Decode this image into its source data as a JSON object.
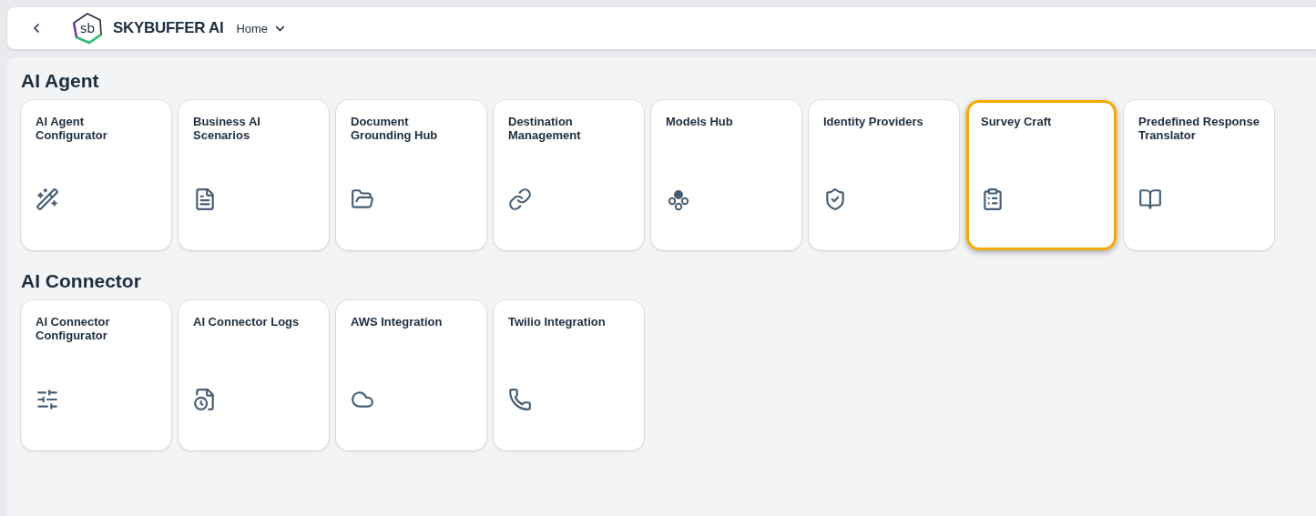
{
  "header": {
    "brand": "SKYBUFFER AI",
    "logo_text": "sb",
    "menu": "Home"
  },
  "groups": [
    {
      "title": "AI Agent",
      "tiles": [
        {
          "title": "AI Agent Configurator",
          "selected": false
        },
        {
          "title": "Business AI Scenarios",
          "selected": false
        },
        {
          "title": "Document Grounding Hub",
          "selected": false
        },
        {
          "title": "Destination Management",
          "selected": false
        },
        {
          "title": "Models Hub",
          "selected": false
        },
        {
          "title": "Identity Providers",
          "selected": false
        },
        {
          "title": "Survey Craft",
          "selected": true
        },
        {
          "title": "Predefined Response Translator",
          "selected": false
        }
      ]
    },
    {
      "title": "AI Connector",
      "tiles": [
        {
          "title": "AI Connector Configurator",
          "selected": false
        },
        {
          "title": "AI Connector Logs",
          "selected": false
        },
        {
          "title": "AWS Integration",
          "selected": false
        },
        {
          "title": "Twilio Integration",
          "selected": false
        }
      ]
    }
  ]
}
